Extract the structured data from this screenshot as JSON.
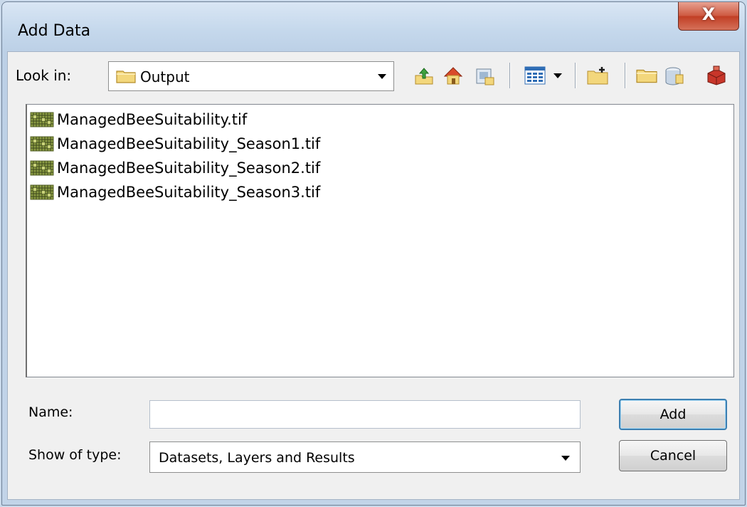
{
  "window": {
    "title": "Add Data",
    "close_glyph": "X"
  },
  "look_in": {
    "label": "Look in:",
    "value": "Output",
    "icon": "folder-icon"
  },
  "toolbar": {
    "icons": [
      "go-up-one-level-icon",
      "go-to-default-home-icon",
      "connect-to-folder-icon",
      "view-menu-icon",
      "new-folder-icon",
      "folder-icon",
      "geodatabase-icon",
      "toolbox-icon"
    ]
  },
  "files": [
    {
      "name": "ManagedBeeSuitability.tif",
      "icon": "raster-dataset-icon"
    },
    {
      "name": "ManagedBeeSuitability_Season1.tif",
      "icon": "raster-dataset-icon"
    },
    {
      "name": "ManagedBeeSuitability_Season2.tif",
      "icon": "raster-dataset-icon"
    },
    {
      "name": "ManagedBeeSuitability_Season3.tif",
      "icon": "raster-dataset-icon"
    }
  ],
  "name_field": {
    "label": "Name:",
    "value": ""
  },
  "type_field": {
    "label": "Show of type:",
    "value": "Datasets, Layers and Results"
  },
  "buttons": {
    "add": "Add",
    "cancel": "Cancel"
  },
  "colors": {
    "titlebar": "#c5d8ec",
    "close_button": "#c94a30",
    "client": "#f0f0f0",
    "default_button_border": "#3c7fb1"
  }
}
